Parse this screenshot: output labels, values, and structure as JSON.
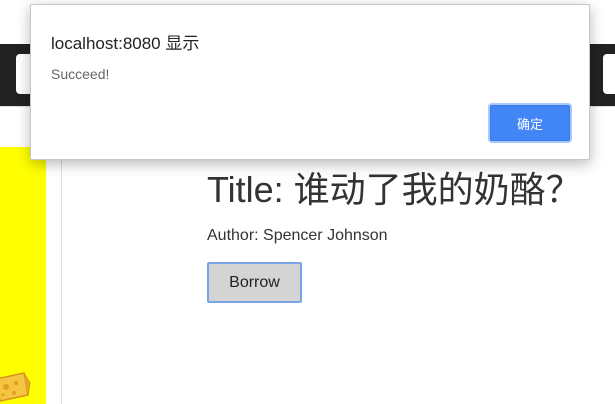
{
  "dialog": {
    "title": "localhost:8080 显示",
    "message": "Succeed!",
    "ok_label": "确定",
    "accent_color": "#4285f4"
  },
  "book": {
    "title": "Title: 谁动了我的奶酪？",
    "author": "Author: Spencer Johnson",
    "borrow_label": "Borrow",
    "cover_color": "#ffff00"
  },
  "theme": {
    "topbar_color": "#222222"
  }
}
